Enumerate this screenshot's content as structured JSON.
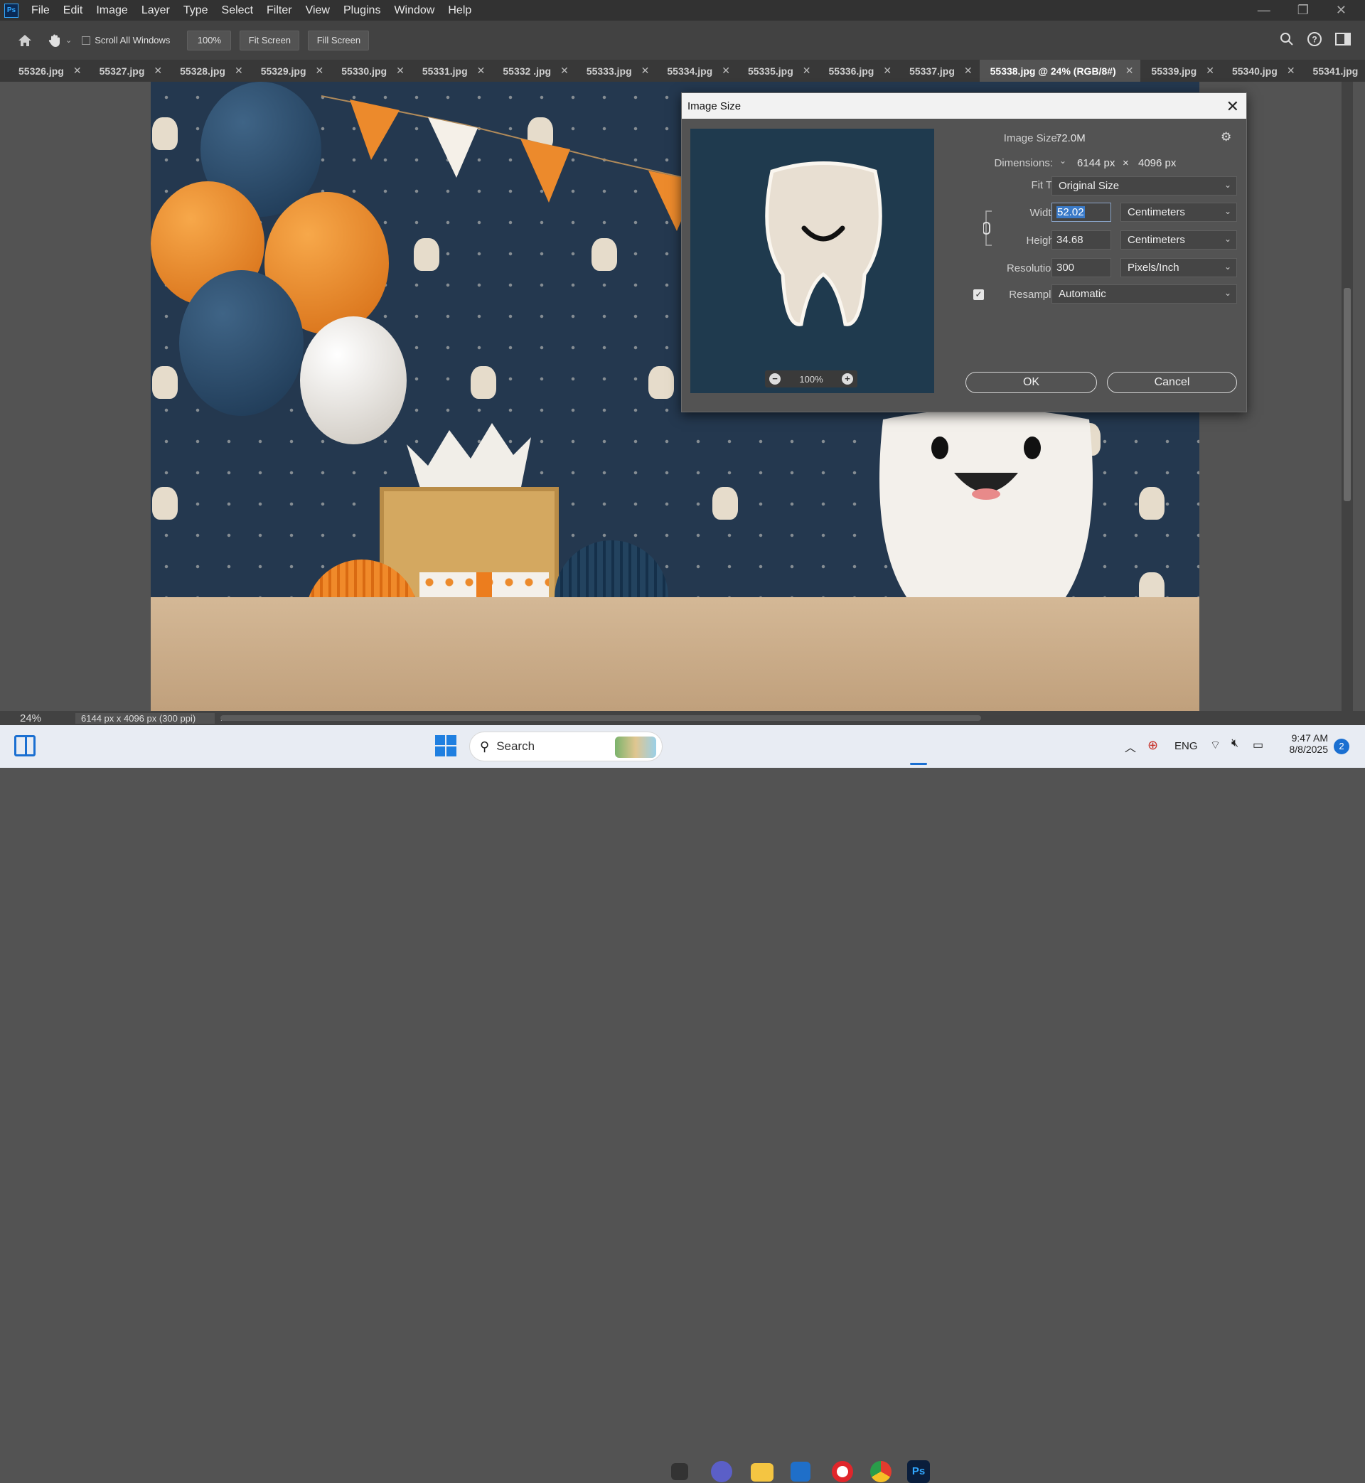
{
  "app": {
    "logo": "Ps"
  },
  "menu": [
    "File",
    "Edit",
    "Image",
    "Layer",
    "Type",
    "Select",
    "Filter",
    "View",
    "Plugins",
    "Window",
    "Help"
  ],
  "window_controls": {
    "minimize": "—",
    "restore": "❐",
    "close": "✕"
  },
  "options": {
    "scroll_all_windows": "Scroll All Windows",
    "zoom": "100%",
    "fit_screen": "Fit Screen",
    "fill_screen": "Fill Screen"
  },
  "tabs": [
    {
      "label": "55326.jpg"
    },
    {
      "label": "55327.jpg"
    },
    {
      "label": "55328.jpg"
    },
    {
      "label": "55329.jpg"
    },
    {
      "label": "55330.jpg"
    },
    {
      "label": "55331.jpg"
    },
    {
      "label": "55332 .jpg"
    },
    {
      "label": "55333.jpg"
    },
    {
      "label": "55334.jpg"
    },
    {
      "label": "55335.jpg"
    },
    {
      "label": "55336.jpg"
    },
    {
      "label": "55337.jpg"
    },
    {
      "label": "55338.jpg @ 24% (RGB/8#)",
      "active": true
    },
    {
      "label": "55339.jpg"
    },
    {
      "label": "55340.jpg"
    },
    {
      "label": "55341.jpg"
    }
  ],
  "tab_overflow": "»",
  "status": {
    "zoom": "24%",
    "info": "6144 px x 4096 px (300 ppi)",
    "arrow": "›"
  },
  "dialog": {
    "title": "Image Size",
    "close": "✕",
    "image_size_label": "Image Size:",
    "image_size_value": "72.0M",
    "dimensions_label": "Dimensions:",
    "dim_w": "6144 px",
    "dim_x": "×",
    "dim_h": "4096 px",
    "fit_label": "Fit T...",
    "fit_value": "Original Size",
    "width_label": "Width:",
    "width_value": "52.02",
    "width_unit": "Centimeters",
    "height_label": "Height:",
    "height_value": "34.68",
    "height_unit": "Centimeters",
    "resolution_label": "Resolution:",
    "resolution_value": "300",
    "resolution_unit": "Pixels/Inch",
    "resample_label": "Resample:",
    "resample_value": "Automatic",
    "resample_checked": true,
    "preview_zoom": "100%",
    "ok": "OK",
    "cancel": "Cancel"
  },
  "taskbar": {
    "search": "Search",
    "lang": "ENG",
    "time": "9:47 AM",
    "date": "8/8/2025",
    "badge": "2"
  }
}
